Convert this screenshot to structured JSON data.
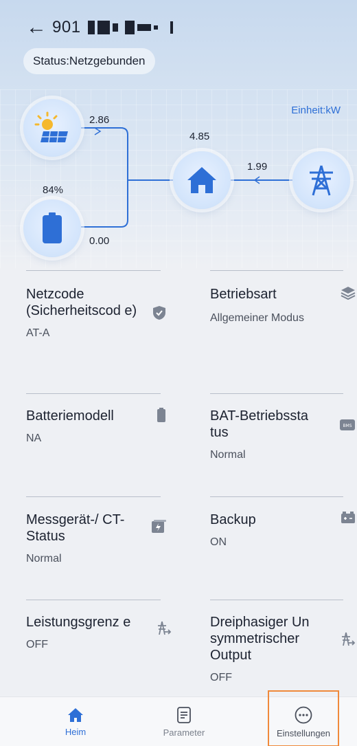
{
  "header": {
    "back_symbol": "←",
    "device_id_prefix": "901",
    "status_text": "Status:Netzgebunden",
    "unit_label": "Einheit:kW"
  },
  "energy_flow": {
    "pv_power": "2.86",
    "battery_soc": "84%",
    "battery_power": "0.00",
    "home_power": "4.85",
    "grid_power": "1.99",
    "icons": [
      "solar-panel-icon",
      "battery-icon",
      "home-icon",
      "grid-tower-icon"
    ],
    "accent_color": "#2e6fd6"
  },
  "settings": [
    {
      "title": "Netzcode (Sicherheitscod e)",
      "value": "AT-A",
      "icon": "shield-check-icon"
    },
    {
      "title": "Betriebsart",
      "value": "Allgemeiner Modus",
      "icon": "layers-icon"
    },
    {
      "title": "Batteriemodell",
      "value": "NA",
      "icon": "battery-small-icon"
    },
    {
      "title": "BAT-Betriebssta tus",
      "value": "Normal",
      "icon": "bms-icon"
    },
    {
      "title": "Messgerät-/ CT-Status",
      "value": "Normal",
      "icon": "meter-icon"
    },
    {
      "title": "Backup",
      "value": "ON",
      "icon": "backup-battery-icon"
    },
    {
      "title": "Leistungsgrenz e",
      "value": "OFF",
      "icon": "power-limit-icon"
    },
    {
      "title": "Dreiphasiger Un symmetrischer Output",
      "value": "OFF",
      "icon": "three-phase-icon"
    }
  ],
  "tabs": [
    {
      "label": "Heim",
      "icon": "home-tab-icon",
      "active": true
    },
    {
      "label": "Parameter",
      "icon": "document-tab-icon",
      "active": false
    },
    {
      "label": "Einstellungen",
      "icon": "more-dots-tab-icon",
      "active": false
    }
  ]
}
